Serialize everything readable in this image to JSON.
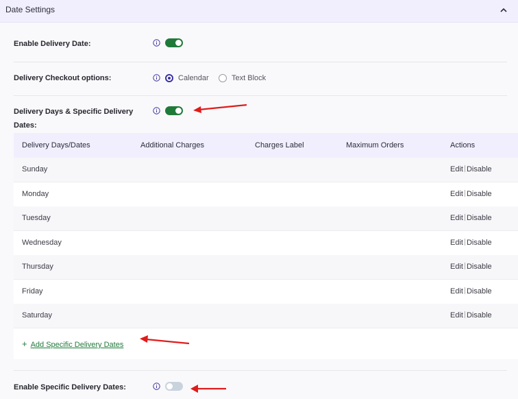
{
  "header": {
    "title": "Date Settings",
    "collapse_icon": "chevron-up-icon"
  },
  "settings": {
    "enable_delivery_date": {
      "label": "Enable Delivery Date:",
      "enabled": true
    },
    "checkout_options": {
      "label": "Delivery Checkout options:",
      "options": [
        "Calendar",
        "Text Block"
      ],
      "selected": "Calendar"
    },
    "delivery_days": {
      "label_line1": "Delivery Days & Specific Delivery",
      "label_line2": "Dates:",
      "enabled": true
    },
    "enable_specific_dates": {
      "label": "Enable Specific Delivery Dates:",
      "enabled": false
    }
  },
  "table": {
    "headers": [
      "Delivery Days/Dates",
      "Additional Charges",
      "Charges Label",
      "Maximum Orders",
      "Actions"
    ],
    "rows": [
      {
        "day": "Sunday",
        "edit": "Edit",
        "disable": "Disable"
      },
      {
        "day": "Monday",
        "edit": "Edit",
        "disable": "Disable"
      },
      {
        "day": "Tuesday",
        "edit": "Edit",
        "disable": "Disable"
      },
      {
        "day": "Wednesday",
        "edit": "Edit",
        "disable": "Disable"
      },
      {
        "day": "Thursday",
        "edit": "Edit",
        "disable": "Disable"
      },
      {
        "day": "Friday",
        "edit": "Edit",
        "disable": "Disable"
      },
      {
        "day": "Saturday",
        "edit": "Edit",
        "disable": "Disable"
      }
    ]
  },
  "add_link": {
    "plus": "+",
    "label": "Add Specific Delivery Dates"
  },
  "colors": {
    "accent_green": "#1f7a3a",
    "header_bg": "#f1effd",
    "radio_purple": "#3b33a0",
    "annotation_red": "#e01b1b"
  }
}
